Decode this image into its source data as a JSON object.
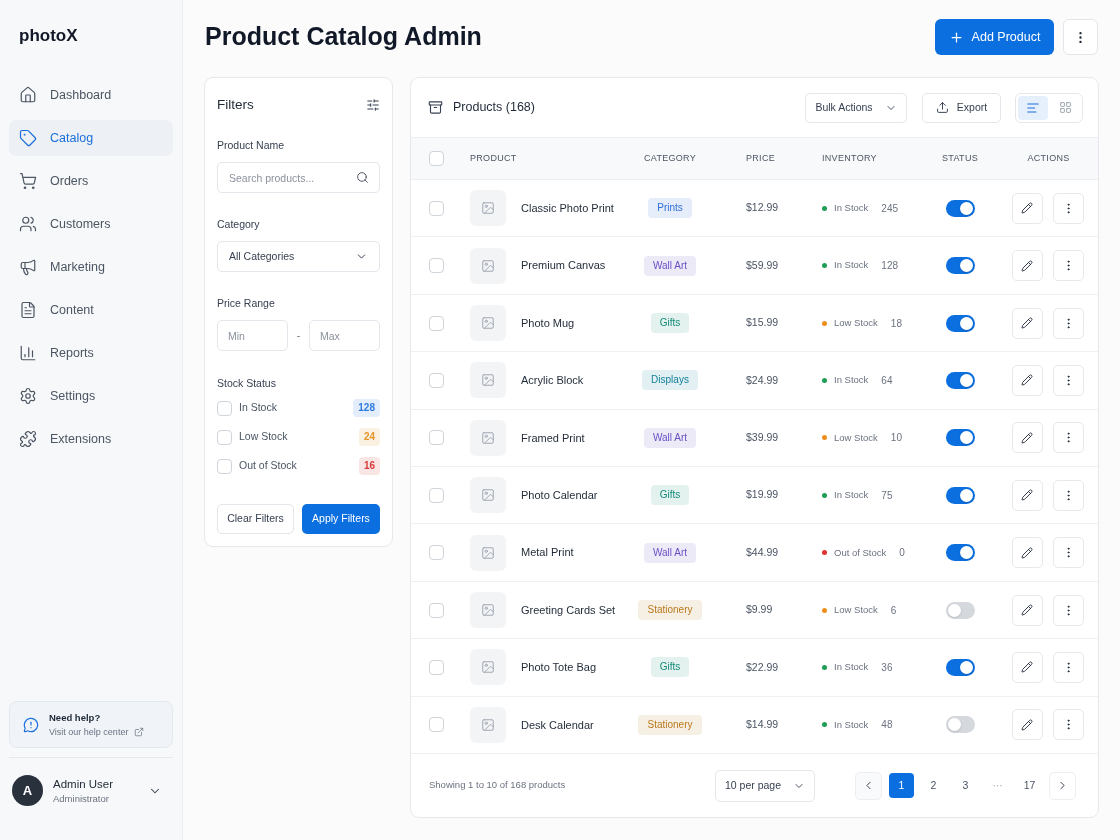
{
  "sidebar": {
    "logo": "photoX",
    "nav": [
      {
        "label": "Dashboard",
        "selected": false
      },
      {
        "label": "Catalog",
        "selected": true
      },
      {
        "label": "Orders",
        "selected": false
      },
      {
        "label": "Customers",
        "selected": false
      },
      {
        "label": "Marketing",
        "selected": false
      },
      {
        "label": "Content",
        "selected": false
      },
      {
        "label": "Reports",
        "selected": false
      },
      {
        "label": "Settings",
        "selected": false
      },
      {
        "label": "Extensions",
        "selected": false
      }
    ],
    "help": {
      "title": "Need help?",
      "link": "Visit our help center"
    },
    "user": {
      "initial": "A",
      "name": "Admin User",
      "role": "Administrator"
    }
  },
  "header": {
    "title": "Product Catalog Admin",
    "primary_button": "Add Product"
  },
  "filters": {
    "title": "Filters",
    "product_name": {
      "label": "Product Name",
      "placeholder": "Search products..."
    },
    "category": {
      "label": "Category",
      "value": "All Categories"
    },
    "price_range": {
      "label": "Price Range",
      "min_placeholder": "Min",
      "separator": "-",
      "max_placeholder": "Max"
    },
    "stock_status": {
      "label": "Stock Status",
      "options": [
        {
          "label": "In Stock",
          "count": "128",
          "checked": false,
          "color": "#2d7be0"
        },
        {
          "label": "Low Stock",
          "count": "24",
          "checked": false,
          "color": "#e3952a"
        },
        {
          "label": "Out of Stock",
          "count": "16",
          "checked": false,
          "color": "#d83a3a"
        }
      ]
    },
    "buttons": {
      "clear": "Clear Filters",
      "apply": "Apply Filters"
    }
  },
  "products": {
    "title": "Products (168)",
    "bulk_actions": "Bulk Actions",
    "export": "Export",
    "views": [
      {
        "kind": "list",
        "selected": true
      },
      {
        "kind": "grid",
        "selected": false
      }
    ],
    "table": {
      "all_checked": false,
      "columns": [
        "PRODUCT",
        "CATEGORY",
        "PRICE",
        "INVENTORY",
        "STATUS",
        "ACTIONS"
      ],
      "rows": [
        {
          "checked": false,
          "name": "Classic Photo Print",
          "category": {
            "label": "Prints",
            "color": "#2f6fd8"
          },
          "price": "$12.99",
          "stock": {
            "label": "In Stock",
            "count": "245",
            "color": "#1f9d55"
          },
          "active": true
        },
        {
          "checked": false,
          "name": "Premium Canvas",
          "category": {
            "label": "Wall Art",
            "color": "#6a4fc6"
          },
          "price": "$59.99",
          "stock": {
            "label": "In Stock",
            "count": "128",
            "color": "#1f9d55"
          },
          "active": true
        },
        {
          "checked": false,
          "name": "Photo Mug",
          "category": {
            "label": "Gifts",
            "color": "#158a7a"
          },
          "price": "$15.99",
          "stock": {
            "label": "Low Stock",
            "count": "18",
            "color": "#ee8f1b"
          },
          "active": true
        },
        {
          "checked": false,
          "name": "Acrylic Block",
          "category": {
            "label": "Displays",
            "color": "#12809a"
          },
          "price": "$24.99",
          "stock": {
            "label": "In Stock",
            "count": "64",
            "color": "#1f9d55"
          },
          "active": true
        },
        {
          "checked": false,
          "name": "Framed Print",
          "category": {
            "label": "Wall Art",
            "color": "#6a4fc6"
          },
          "price": "$39.99",
          "stock": {
            "label": "Low Stock",
            "count": "10",
            "color": "#ee8f1b"
          },
          "active": true
        },
        {
          "checked": false,
          "name": "Photo Calendar",
          "category": {
            "label": "Gifts",
            "color": "#158a7a"
          },
          "price": "$19.99",
          "stock": {
            "label": "In Stock",
            "count": "75",
            "color": "#1f9d55"
          },
          "active": true
        },
        {
          "checked": false,
          "name": "Metal Print",
          "category": {
            "label": "Wall Art",
            "color": "#6a4fc6"
          },
          "price": "$44.99",
          "stock": {
            "label": "Out of Stock",
            "count": "0",
            "color": "#e03131"
          },
          "active": true
        },
        {
          "checked": false,
          "name": "Greeting Cards Set",
          "category": {
            "label": "Stationery",
            "color": "#b9791c"
          },
          "price": "$9.99",
          "stock": {
            "label": "Low Stock",
            "count": "6",
            "color": "#ee8f1b"
          },
          "active": false
        },
        {
          "checked": false,
          "name": "Photo Tote Bag",
          "category": {
            "label": "Gifts",
            "color": "#158a7a"
          },
          "price": "$22.99",
          "stock": {
            "label": "In Stock",
            "count": "36",
            "color": "#1f9d55"
          },
          "active": true
        },
        {
          "checked": false,
          "name": "Desk Calendar",
          "category": {
            "label": "Stationery",
            "color": "#b9791c"
          },
          "price": "$14.99",
          "stock": {
            "label": "In Stock",
            "count": "48",
            "color": "#1f9d55"
          },
          "active": false
        }
      ]
    },
    "footer": {
      "summary": "Showing 1 to 10 of 168 products",
      "per_page": "10 per page",
      "pages": [
        {
          "label": "1",
          "kind": "page",
          "selected": true
        },
        {
          "label": "2",
          "kind": "page",
          "selected": false
        },
        {
          "label": "3",
          "kind": "page",
          "selected": false
        },
        {
          "label": "···",
          "kind": "gap",
          "selected": false
        },
        {
          "label": "17",
          "kind": "page",
          "selected": false
        }
      ]
    }
  }
}
